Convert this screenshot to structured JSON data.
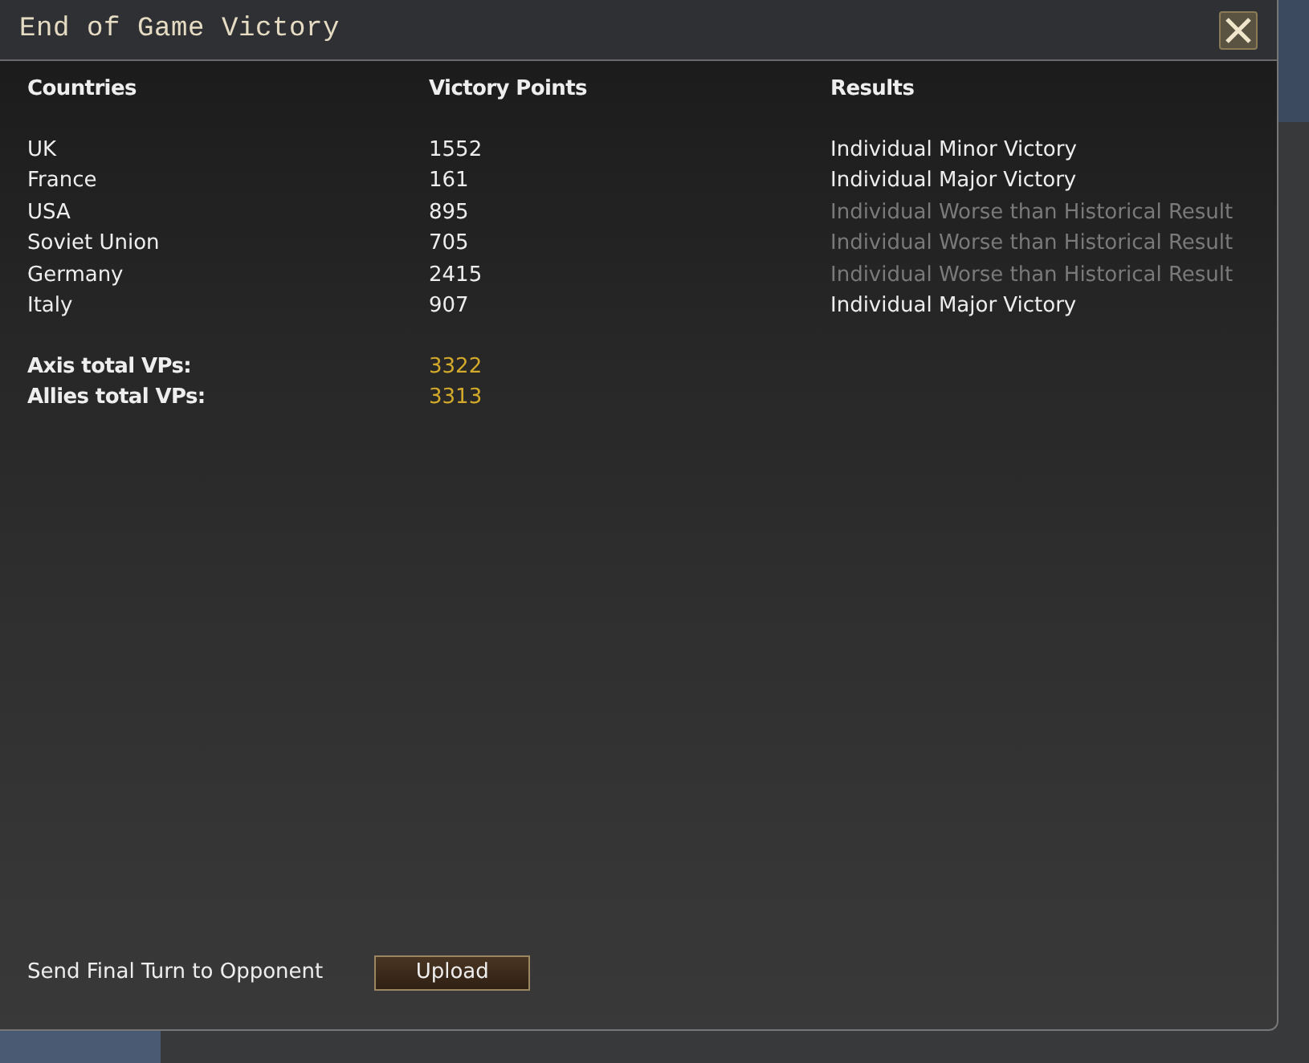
{
  "window": {
    "title": "End of Game Victory"
  },
  "table": {
    "columns": [
      "Countries",
      "Victory Points",
      "Results"
    ],
    "rows": [
      {
        "country": "UK",
        "points": "1552",
        "result": "Individual Minor Victory",
        "dimmed": false
      },
      {
        "country": "France",
        "points": "161",
        "result": "Individual Major Victory",
        "dimmed": false
      },
      {
        "country": "USA",
        "points": "895",
        "result": "Individual Worse than Historical Result",
        "dimmed": true
      },
      {
        "country": "Soviet Union",
        "points": "705",
        "result": "Individual Worse than Historical Result",
        "dimmed": true
      },
      {
        "country": "Germany",
        "points": "2415",
        "result": "Individual Worse than Historical Result",
        "dimmed": true
      },
      {
        "country": "Italy",
        "points": "907",
        "result": "Individual Major Victory",
        "dimmed": false
      }
    ]
  },
  "totals": [
    {
      "label": "Axis total VPs:",
      "value": "3322"
    },
    {
      "label": "Allies total VPs:",
      "value": "3313"
    }
  ],
  "footer": {
    "label": "Send Final Turn to Opponent",
    "button": "Upload"
  }
}
